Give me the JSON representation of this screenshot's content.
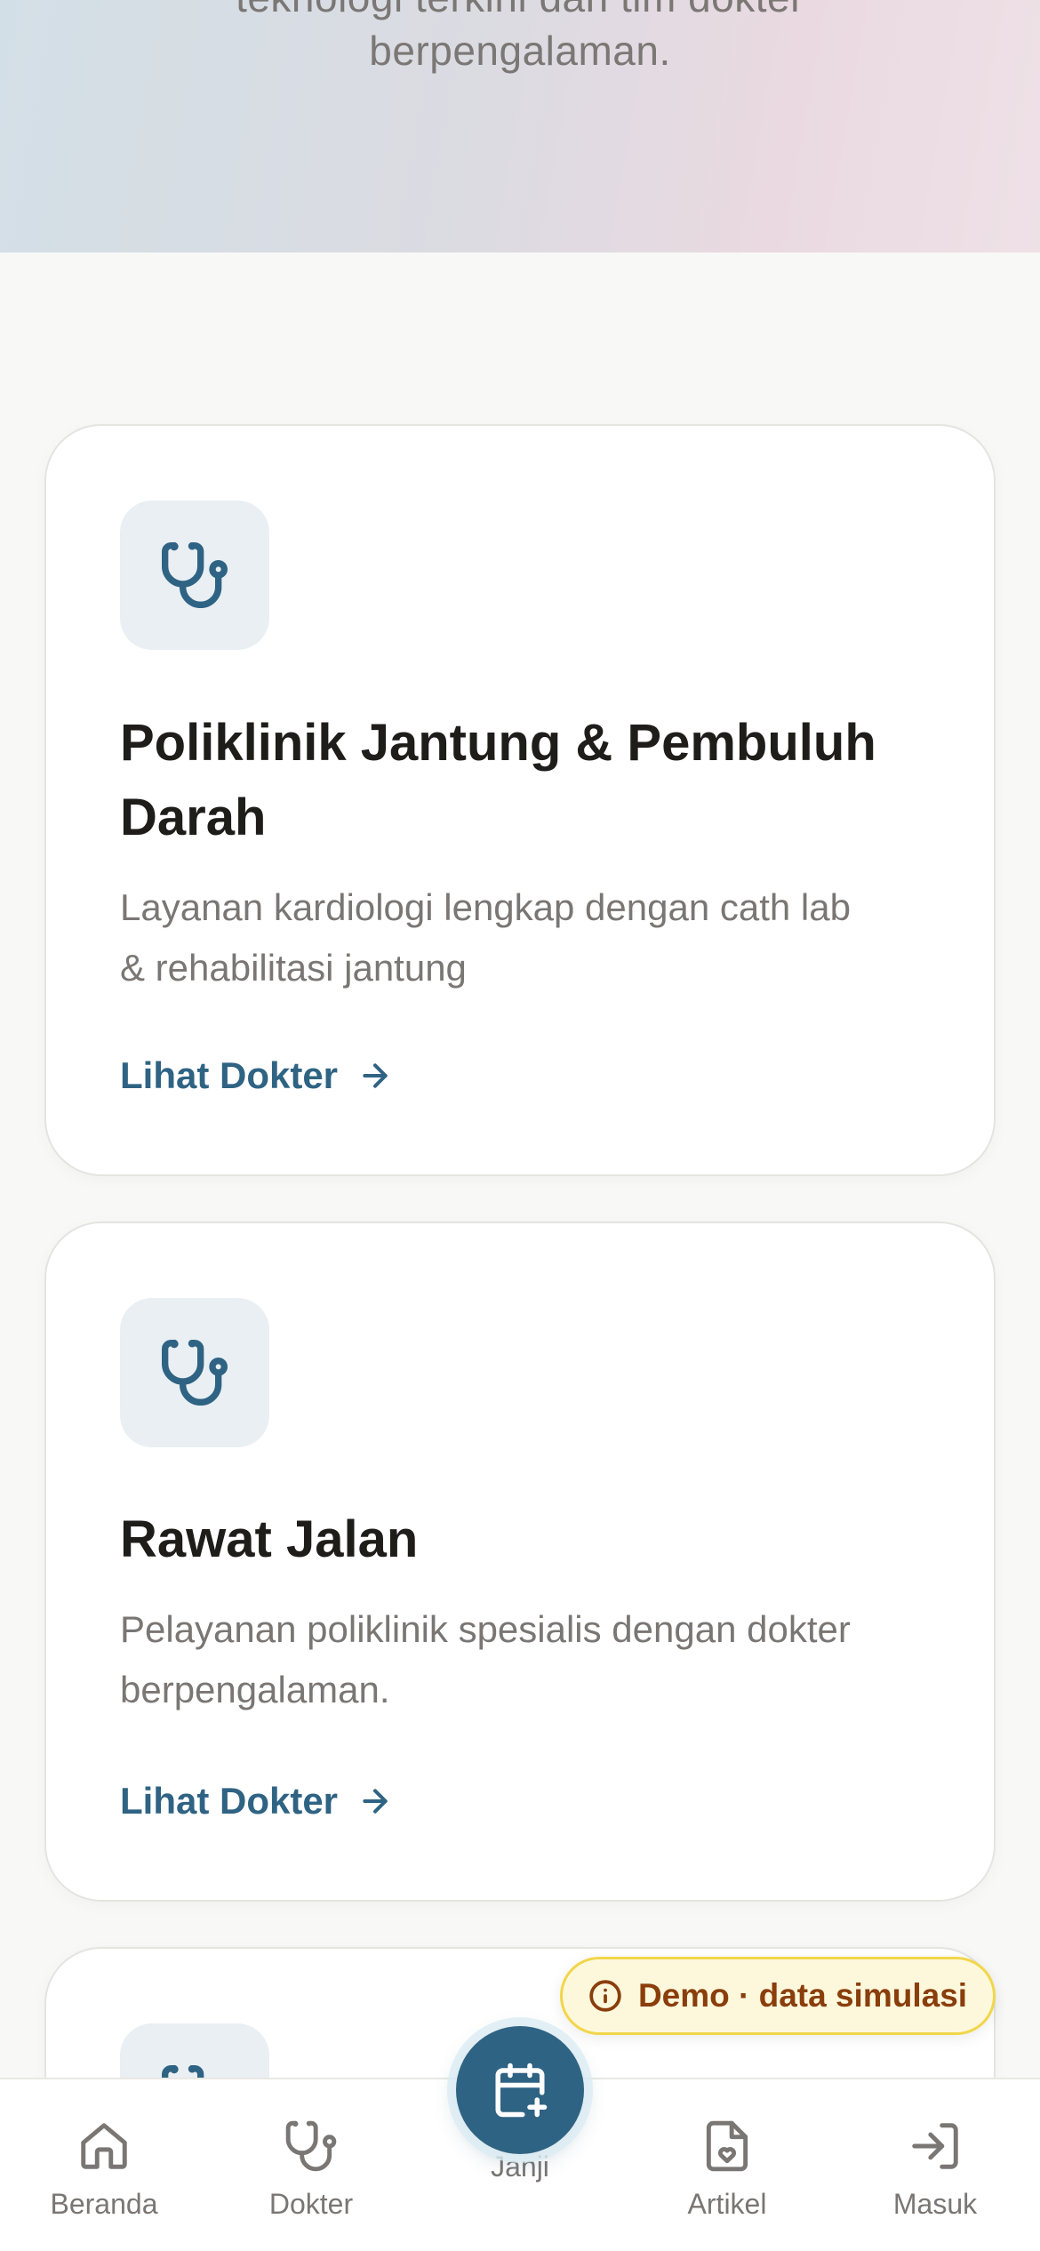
{
  "hero": {
    "line1": "teknologi terkini dan tim dokter",
    "line2": "berpengalaman."
  },
  "services": [
    {
      "icon": "stethoscope-icon",
      "title_line1": "Poliklinik Jantung & Pembuluh",
      "title_line2": "Darah",
      "desc_line1": "Layanan kardiologi lengkap dengan cath lab",
      "desc_line2": "& rehabilitasi jantung",
      "link_label": "Lihat Dokter"
    },
    {
      "icon": "stethoscope-icon",
      "title_line1": "Rawat Jalan",
      "desc_line1": "Pelayanan poliklinik spesialis dengan dokter",
      "desc_line2": "berpengalaman.",
      "link_label": "Lihat Dokter"
    },
    {
      "icon": "stethoscope-icon"
    }
  ],
  "demo_badge": {
    "icon": "info-icon",
    "label": "Demo · data simulasi"
  },
  "nav": {
    "items": [
      {
        "icon": "home-icon",
        "label": "Beranda"
      },
      {
        "icon": "stethoscope-icon",
        "label": "Dokter"
      },
      {
        "icon": "calendar-plus-icon",
        "label": "Janji"
      },
      {
        "icon": "document-heart-icon",
        "label": "Artikel"
      },
      {
        "icon": "login-icon",
        "label": "Masuk"
      }
    ]
  },
  "colors": {
    "accent": "#2f6383",
    "icon_bg": "#e9eff3",
    "badge_bg": "#fdf8dc",
    "badge_border": "#f2d64a",
    "badge_text": "#8a3e0c"
  }
}
